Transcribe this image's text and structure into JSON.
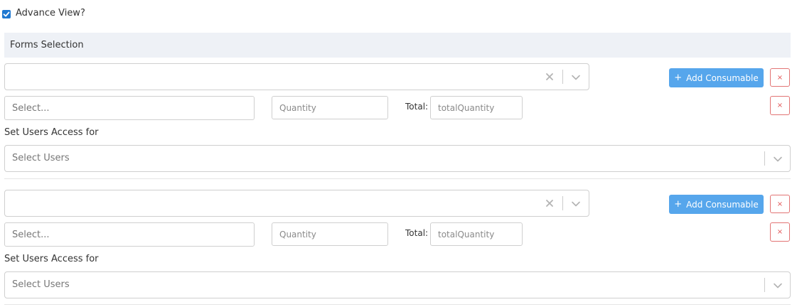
{
  "advance_view": {
    "label": "Advance View?",
    "checked": true
  },
  "forms_selection": {
    "title": "Forms Selection"
  },
  "blocks": [
    {
      "consumable_select": {
        "value": ""
      },
      "add_button": "Add Consumable",
      "remove_block_icon": "×",
      "item_select": {
        "placeholder": "Select..."
      },
      "quantity": {
        "placeholder": "Quantity"
      },
      "total": {
        "label": "Total:",
        "placeholder": "totalQuantity"
      },
      "remove_row_icon": "×",
      "users_access": {
        "label": "Set Users Access for",
        "placeholder": "Select Users"
      }
    },
    {
      "consumable_select": {
        "value": ""
      },
      "add_button": "Add Consumable",
      "remove_block_icon": "×",
      "item_select": {
        "placeholder": "Select..."
      },
      "quantity": {
        "placeholder": "Quantity"
      },
      "total": {
        "label": "Total:",
        "placeholder": "totalQuantity"
      },
      "remove_row_icon": "×",
      "users_access": {
        "label": "Set Users Access for",
        "placeholder": "Select Users"
      }
    }
  ],
  "colors": {
    "accent": "#56a6ec",
    "danger": "#e25555",
    "checkbox": "#1f78d1",
    "band": "#eef1f6"
  },
  "icons": {
    "clear": "close-icon",
    "dropdown": "chevron-down-icon",
    "plus": "plus-icon",
    "check": "check-icon"
  }
}
